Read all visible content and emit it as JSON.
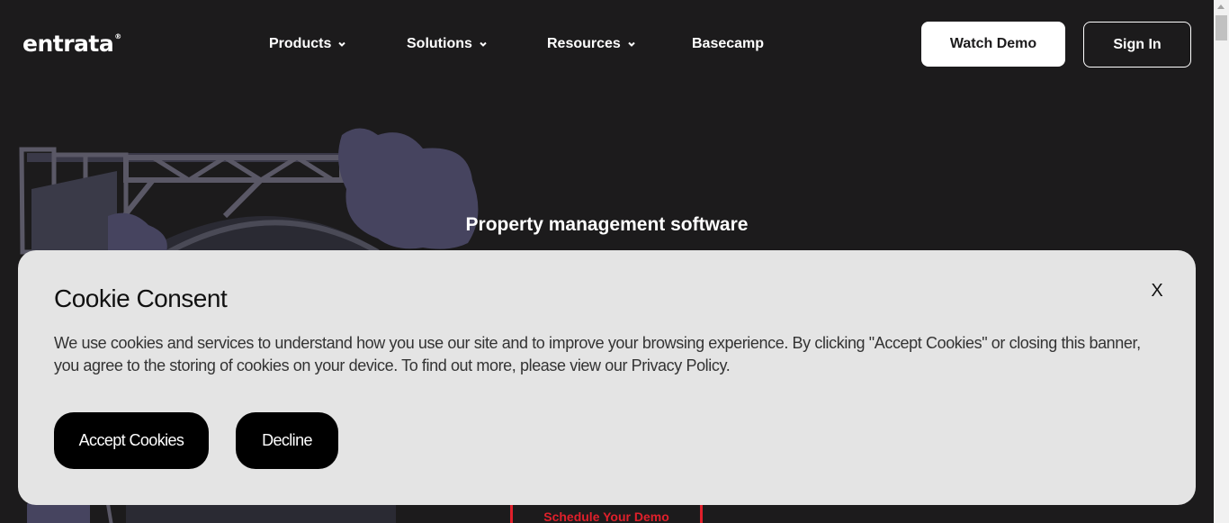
{
  "header": {
    "logo": "entrata",
    "logo_mark": "®",
    "nav": [
      {
        "label": "Products",
        "has_dropdown": true
      },
      {
        "label": "Solutions",
        "has_dropdown": true
      },
      {
        "label": "Resources",
        "has_dropdown": true
      },
      {
        "label": "Basecamp",
        "has_dropdown": false
      }
    ],
    "watch_demo": "Watch Demo",
    "sign_in": "Sign In"
  },
  "hero": {
    "title": "Property management software",
    "cta": "Schedule Your Demo"
  },
  "cookie": {
    "title": "Cookie Consent",
    "close": "X",
    "body": "We use cookies and services to understand how you use our site and to improve your browsing experience. By clicking \"Accept Cookies\" or closing this banner, you agree to the storing of cookies on your device. To find out more, please view our Privacy Policy.",
    "accept": "Accept Cookies",
    "decline": "Decline"
  },
  "colors": {
    "background": "#1c1b1c",
    "accent": "#e0202b",
    "banner": "#e4e4e4",
    "illustration": "#4a4866"
  },
  "icons": [
    "chevron-down-icon"
  ]
}
